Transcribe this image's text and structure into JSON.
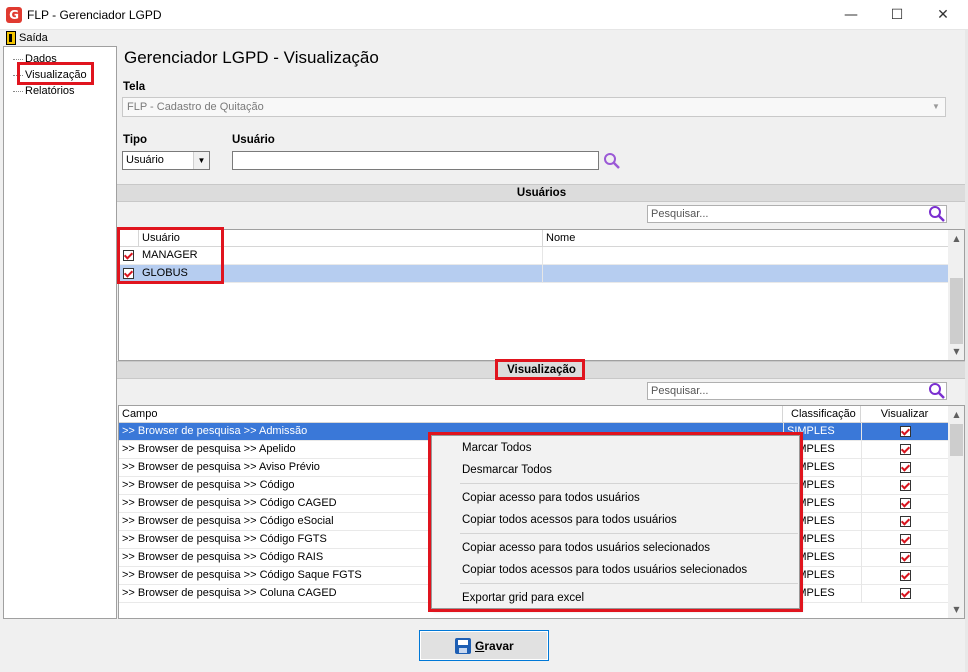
{
  "window": {
    "title": "FLP - Gerenciador LGPD",
    "logo_letter": "G",
    "minimize": "—",
    "maximize": "☐",
    "close": "✕"
  },
  "menu": {
    "exit_label": "Saída"
  },
  "sidebar": {
    "items": [
      {
        "label": "Dados"
      },
      {
        "label": "Visualização",
        "selected": true
      },
      {
        "label": "Relatórios"
      }
    ]
  },
  "main": {
    "title": "Gerenciador LGPD - Visualização",
    "tela_label": "Tela",
    "tela_value": "FLP - Cadastro de Quitação",
    "tipo_label": "Tipo",
    "tipo_value": "Usuário",
    "usuario_label": "Usuário",
    "usuario_value": ""
  },
  "users_section": {
    "title": "Usuários",
    "search_placeholder": "Pesquisar...",
    "columns": [
      "Usuário",
      "Nome"
    ],
    "rows": [
      {
        "usuario": "MANAGER",
        "nome": "",
        "checked": true,
        "selected": false
      },
      {
        "usuario": "GLOBUS",
        "nome": "",
        "checked": true,
        "selected": true
      }
    ]
  },
  "view_section": {
    "title": "Visualização",
    "search_placeholder": "Pesquisar...",
    "columns": [
      "Campo",
      "Classificação",
      "Visualizar"
    ],
    "rows": [
      {
        "campo": ">> Browser de pesquisa >> Admissão",
        "classificacao": "SIMPLES",
        "visualizar": true,
        "selected": true
      },
      {
        "campo": ">> Browser de pesquisa >> Apelido",
        "classificacao": "SIMPLES",
        "visualizar": true
      },
      {
        "campo": ">> Browser de pesquisa >> Aviso Prévio",
        "classificacao": "SIMPLES",
        "visualizar": true
      },
      {
        "campo": ">> Browser de pesquisa >> Código",
        "classificacao": "SIMPLES",
        "visualizar": true
      },
      {
        "campo": ">> Browser de pesquisa >> Código CAGED",
        "classificacao": "SIMPLES",
        "visualizar": true
      },
      {
        "campo": ">> Browser de pesquisa >> Código eSocial",
        "classificacao": "SIMPLES",
        "visualizar": true
      },
      {
        "campo": ">> Browser de pesquisa >> Código FGTS",
        "classificacao": "SIMPLES",
        "visualizar": true
      },
      {
        "campo": ">> Browser de pesquisa >> Código RAIS",
        "classificacao": "SIMPLES",
        "visualizar": true
      },
      {
        "campo": ">> Browser de pesquisa >> Código Saque FGTS",
        "classificacao": "SIMPLES",
        "visualizar": true
      },
      {
        "campo": ">> Browser de pesquisa >> Coluna CAGED",
        "classificacao": "SIMPLES",
        "visualizar": true
      }
    ]
  },
  "context_menu": {
    "items": [
      "Marcar Todos",
      "Desmarcar Todos",
      "Copiar acesso para todos usuários",
      "Copiar todos acessos para todos usuários",
      "Copiar acesso para todos usuários selecionados",
      "Copiar todos acessos para todos usuários selecionados",
      "Exportar grid para excel"
    ]
  },
  "footer": {
    "save_label_prefix": "G",
    "save_label_rest": "ravar"
  },
  "colors": {
    "highlight": "#e0141e",
    "selection": "#3a78d8",
    "accent": "#0078d7"
  }
}
